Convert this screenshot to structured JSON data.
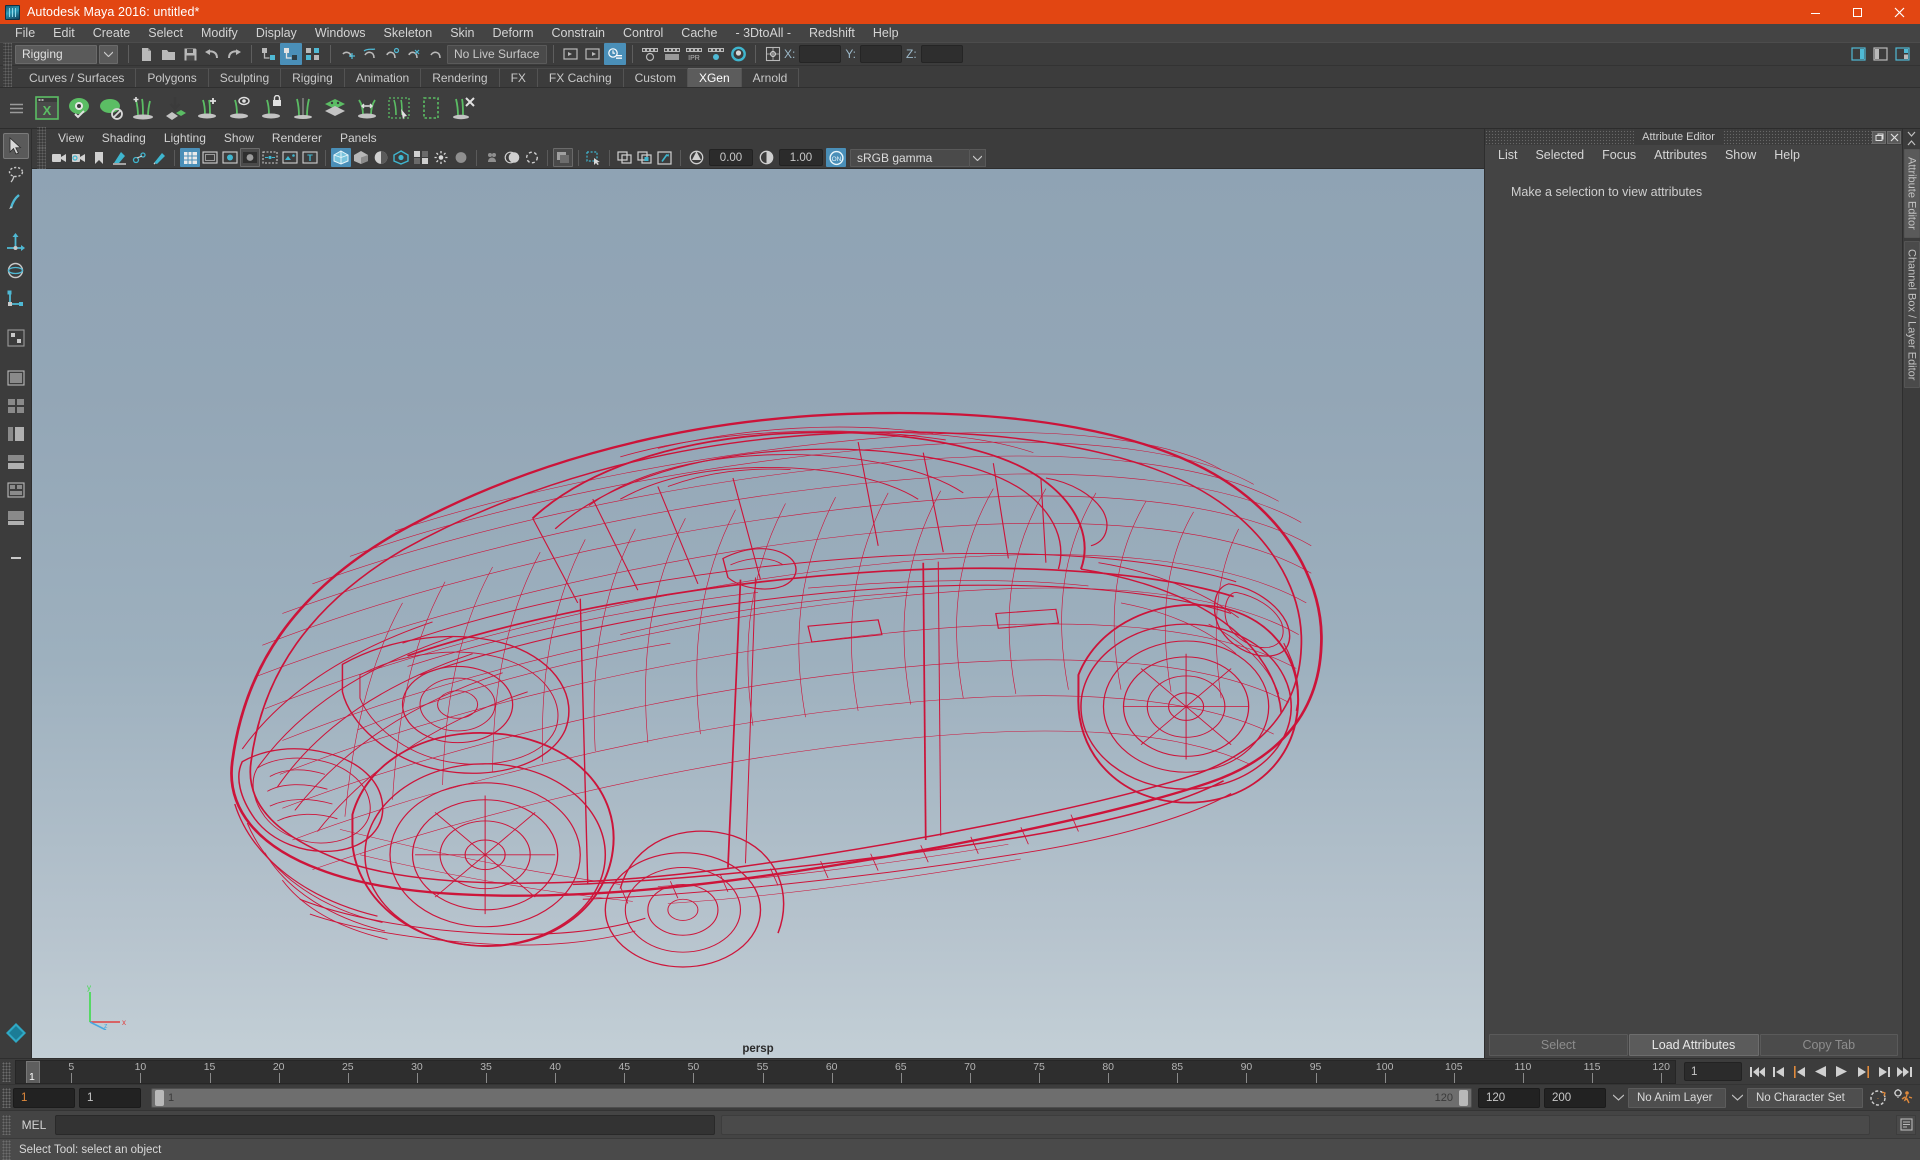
{
  "window": {
    "title": "Autodesk Maya 2016: untitled*",
    "logo_icon": "maya-logo-icon",
    "minimize_icon": "minimize-icon",
    "maximize_icon": "maximize-icon",
    "close_icon": "close-icon",
    "accent_color": "#e24612"
  },
  "menubar": {
    "items": [
      "File",
      "Edit",
      "Create",
      "Select",
      "Modify",
      "Display",
      "Windows",
      "Skeleton",
      "Skin",
      "Deform",
      "Constrain",
      "Control",
      "Cache",
      "- 3DtoAll -",
      "Redshift",
      "Help"
    ]
  },
  "statusline": {
    "menuset": "Rigging",
    "menuset_arrow_icon": "chevron-down-icon",
    "live_surface": "No Live Surface",
    "coords": {
      "x_label": "X:",
      "y_label": "Y:",
      "z_label": "Z:",
      "x_value": "",
      "y_value": "",
      "z_value": ""
    },
    "icons": [
      "new-scene-icon",
      "open-scene-icon",
      "save-scene-icon",
      "undo-icon",
      "redo-icon",
      "select-hierarchy-icon",
      "select-object-icon",
      "select-component-icon",
      "snap-to-grid-icon",
      "snap-to-curve-icon",
      "snap-to-point-icon",
      "snap-to-projected-center-icon",
      "snap-to-view-plane-icon",
      "make-live-icon",
      "show-hide-editor-icon",
      "open-outliner-icon",
      "open-hypergraph-icon",
      "render-current-frame-icon",
      "ipr-render-icon",
      "render-settings-icon",
      "render-sequence-icon",
      "hypershade-icon"
    ],
    "right_icons": [
      "sidebar-attribute-editor-icon",
      "sidebar-tool-settings-icon",
      "sidebar-channel-box-icon"
    ]
  },
  "shelf": {
    "tabs": [
      "Curves / Surfaces",
      "Polygons",
      "Sculpting",
      "Rigging",
      "Animation",
      "Rendering",
      "FX",
      "FX Caching",
      "Custom",
      "XGen",
      "Arnold"
    ],
    "selected_tab": "XGen",
    "icons": [
      "xgen-window-icon",
      "xgen-preview-icon",
      "xgen-patch-icon",
      "xgen-add-guides-icon",
      "xgen-place-guides-icon",
      "xgen-add-grooming-icon",
      "xgen-eye-grooming-icon",
      "xgen-lock-grooming-icon",
      "xgen-mirror-guides-icon",
      "xgen-layers-icon",
      "xgen-spread-icon",
      "xgen-select-region-icon",
      "xgen-region-icon",
      "xgen-delete-guides-icon"
    ]
  },
  "toolbox": {
    "tools": [
      {
        "name": "select-tool",
        "selected": true
      },
      {
        "name": "lasso-select-tool",
        "selected": false
      },
      {
        "name": "paint-select-tool",
        "selected": false
      },
      {
        "name": "move-tool",
        "selected": false
      },
      {
        "name": "rotate-tool",
        "selected": false
      },
      {
        "name": "scale-tool",
        "selected": false
      },
      {
        "name": "last-tool-used",
        "selected": false
      },
      {
        "name": "single-perspective-layout",
        "selected": false
      },
      {
        "name": "four-view-layout",
        "selected": false
      },
      {
        "name": "persp-outliner-layout",
        "selected": false
      },
      {
        "name": "persp-graph-layout",
        "selected": false
      },
      {
        "name": "hypershade-layout",
        "selected": false
      },
      {
        "name": "persp-trax-layout",
        "selected": false
      },
      {
        "name": "more-layouts",
        "selected": false
      }
    ]
  },
  "viewport": {
    "panel_menu": [
      "View",
      "Shading",
      "Lighting",
      "Show",
      "Renderer",
      "Panels"
    ],
    "toolbar": {
      "exposure_value": "0.00",
      "gamma_value": "1.00",
      "color_profile": "sRGB gamma",
      "color_management_icon": "color-management-on-icon",
      "profile_arrow_icon": "chevron-down-icon",
      "icons": [
        "select-camera-icon",
        "camera-attributes-icon",
        "bookmark-icon",
        "image-plane-icon",
        "twopoint-resolution-icon",
        "grease-pencil-icon",
        "grid-toggle-icon",
        "film-gate-icon",
        "resolution-gate-icon",
        "gate-mask-icon",
        "film-origin-icon",
        "safe-action-icon",
        "title-safe-icon",
        "wireframe-shaded-icon",
        "smooth-shade-all-icon",
        "shade-selected-icon",
        "use-all-lights-icon",
        "shadows-icon",
        "screen-space-ao-icon",
        "motion-blur-icon",
        "multisample-aa-icon",
        "depth-of-field-icon",
        "isolate-select-icon",
        "xray-icon",
        "xray-joints-icon",
        "xray-active-components-icon"
      ]
    },
    "camera_label": "persp",
    "axis_labels": {
      "x": "x",
      "y": "y",
      "z": "z"
    },
    "model_color": "#cf0c33",
    "model_name": "car-wireframe-model"
  },
  "attribute_editor": {
    "title": "Attribute Editor",
    "restore_icon": "restore-panel-icon",
    "close_icon": "close-panel-icon",
    "menu": [
      "List",
      "Selected",
      "Focus",
      "Attributes",
      "Show",
      "Help"
    ],
    "empty_message": "Make a selection to view attributes",
    "buttons": {
      "select": "Select",
      "load": "Load Attributes",
      "copy": "Copy Tab"
    }
  },
  "right_tabs": {
    "items": [
      "Attribute Editor",
      "Channel Box / Layer Editor"
    ]
  },
  "timeline": {
    "current_frame": "1",
    "start_tick": 1,
    "tick_labels": [
      5,
      10,
      15,
      20,
      25,
      30,
      35,
      40,
      45,
      50,
      55,
      60,
      65,
      70,
      75,
      80,
      85,
      90,
      95,
      100,
      105,
      110,
      115,
      120
    ],
    "frame_field": "1",
    "playback_icons": [
      "go-to-start-icon",
      "step-back-keyframe-icon",
      "step-back-frame-icon",
      "play-backwards-icon",
      "play-forwards-icon",
      "step-forward-frame-icon",
      "step-forward-keyframe-icon",
      "go-to-end-icon"
    ]
  },
  "range_slider": {
    "anim_start": "1",
    "range_start": "1",
    "slider_start_label": "1",
    "slider_end_label": "120",
    "range_end": "120",
    "anim_end": "200",
    "anim_layer": "No Anim Layer",
    "character_set": "No Character Set",
    "dropdown_arrow_icon": "chevron-down-icon",
    "auto_key_icon": "auto-keyframe-icon",
    "anim_prefs_icon": "animation-preferences-icon"
  },
  "command_line": {
    "language": "MEL",
    "input_value": "",
    "output_value": "",
    "script_editor_icon": "script-editor-icon"
  },
  "help_line": {
    "message": "Select Tool: select an object"
  }
}
